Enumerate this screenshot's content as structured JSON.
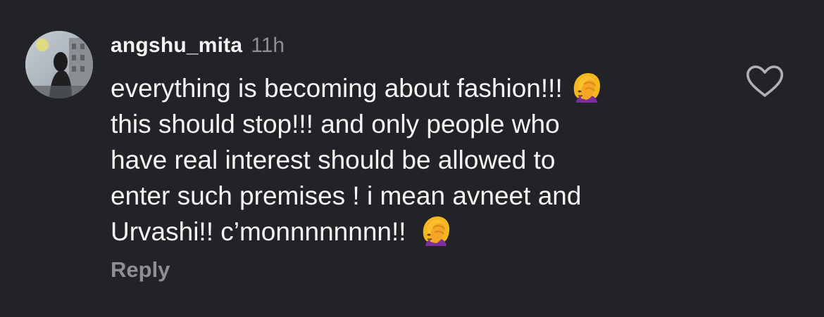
{
  "comment": {
    "username": "angshu_mita",
    "timestamp": "11h",
    "text_lines": [
      "everything is becoming about fashion!!!",
      "this should stop!!! and only people who",
      "have real interest should be allowed to",
      "enter such premises ! i mean avneet and",
      "Urvashi!! c’monnnnnnnn!!"
    ],
    "emoji": "woman-facepalming",
    "reply_label": "Reply",
    "like_icon": "heart-outline-icon"
  },
  "colors": {
    "background": "#222327",
    "primary_text": "#f5f5f5",
    "secondary_text": "#8e8e93"
  }
}
